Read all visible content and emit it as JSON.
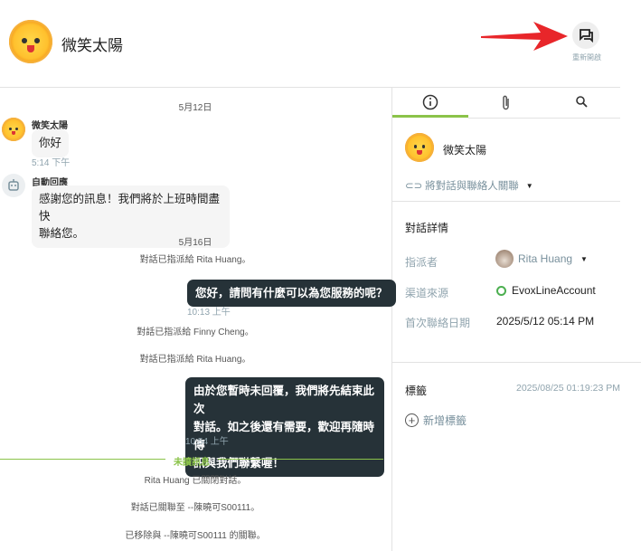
{
  "header": {
    "contact_name": "微笑太陽",
    "reopen_label": "重新開啟",
    "accent_arrow": "#e8262a"
  },
  "messages": {
    "date1": "5月12日",
    "m1_sender": "微笑太陽",
    "m1_text": "你好",
    "m1_time": "5:14 下午",
    "m2_sender": "自動回應",
    "m2_line1": "感謝您的訊息！我們將於上班時間盡快",
    "m2_line2": "聯絡您。",
    "date2": "5月16日",
    "sys1": "對話已指派給 Rita Huang。",
    "m3_text": "您好，請問有什麼可以為您服務的呢？",
    "m3_time": "10:13 上午",
    "sys2": "對話已指派給 Finny Cheng。",
    "sys3": "對話已指派給 Rita Huang。",
    "m4_line1": "由於您暫時未回覆，我們將先結束此次",
    "m4_line2": "對話。如之後還有需要，歡迎再隨時傳",
    "m4_line3": "訊與我們聯繫喔！",
    "m4_time": "10:54 上午",
    "unread": "未讀訊息",
    "sys4": "Rita Huang 已關閉對話。",
    "sys5": "對話已關聯至 --陳曉可S00111。",
    "sys6": "已移除與 --陳曉可S00111 的關聯。"
  },
  "panel": {
    "tabs": [
      "info-icon",
      "paperclip-icon",
      "search-icon"
    ],
    "contact_name": "微笑太陽",
    "link_contact": "將對話與聯絡人關聯",
    "details_title": "對話詳情",
    "assignee_label": "指派者",
    "assignee": "Rita Huang",
    "channel_label": "渠道來源",
    "channel": "EvoxLineAccount",
    "first_contact_label": "首次聯絡日期",
    "first_contact": "2025/5/12 05:14 PM",
    "tags_title": "標籤",
    "tags_time": "2025/08/25 01:19:23 PM",
    "add_tag": "新增標籤",
    "accent": "#8bc34a"
  }
}
